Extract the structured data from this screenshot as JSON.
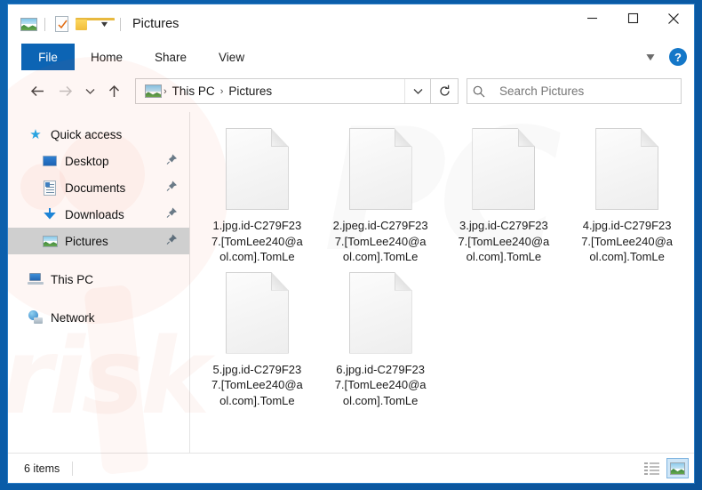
{
  "window": {
    "title": "Pictures",
    "quick_access_toolbar": [
      {
        "name": "pictures-icon",
        "label": "Pictures"
      },
      {
        "name": "properties-icon",
        "label": "Properties"
      },
      {
        "name": "new-folder-icon",
        "label": "New folder"
      },
      {
        "name": "customize-qat-chevron-icon",
        "label": "Customize Quick Access Toolbar"
      }
    ],
    "controls": {
      "minimize": "Minimize",
      "maximize": "Maximize",
      "close": "Close"
    }
  },
  "ribbon": {
    "tabs": [
      {
        "label": "File",
        "active": true
      },
      {
        "label": "Home",
        "active": false
      },
      {
        "label": "Share",
        "active": false
      },
      {
        "label": "View",
        "active": false
      }
    ],
    "collapse_label": "Minimize the Ribbon",
    "help_label": "?"
  },
  "address_bar": {
    "back_label": "Back",
    "forward_label": "Forward",
    "recent_label": "Recent locations",
    "up_label": "Up",
    "breadcrumbs": [
      "This PC",
      "Pictures"
    ],
    "separator": "›",
    "dropdown_label": "Previous locations",
    "refresh_label": "Refresh"
  },
  "search": {
    "placeholder": "Search Pictures",
    "icon": "search-icon"
  },
  "sidebar": {
    "items": [
      {
        "label": "Quick access",
        "icon": "star-icon",
        "indent": false,
        "pinned": false,
        "selected": false
      },
      {
        "label": "Desktop",
        "icon": "desktop-icon",
        "indent": true,
        "pinned": true,
        "selected": false
      },
      {
        "label": "Documents",
        "icon": "documents-icon",
        "indent": true,
        "pinned": true,
        "selected": false
      },
      {
        "label": "Downloads",
        "icon": "downloads-icon",
        "indent": true,
        "pinned": true,
        "selected": false
      },
      {
        "label": "Pictures",
        "icon": "pictures-icon",
        "indent": true,
        "pinned": true,
        "selected": true
      },
      {
        "label": "This PC",
        "icon": "this-pc-icon",
        "indent": false,
        "pinned": false,
        "selected": false
      },
      {
        "label": "Network",
        "icon": "network-icon",
        "indent": false,
        "pinned": false,
        "selected": false
      }
    ]
  },
  "files": [
    {
      "name": "1.jpg.id-C279F237.[TomLee240@aol.com].TomLe",
      "icon": "blank-file-icon"
    },
    {
      "name": "2.jpeg.id-C279F237.[TomLee240@aol.com].TomLe",
      "icon": "blank-file-icon"
    },
    {
      "name": "3.jpg.id-C279F237.[TomLee240@aol.com].TomLe",
      "icon": "blank-file-icon"
    },
    {
      "name": "4.jpg.id-C279F237.[TomLee240@aol.com].TomLe",
      "icon": "blank-file-icon"
    },
    {
      "name": "5.jpg.id-C279F237.[TomLee240@aol.com].TomLe",
      "icon": "blank-file-icon"
    },
    {
      "name": "6.jpg.id-C279F237.[TomLee240@aol.com].TomLe",
      "icon": "blank-file-icon"
    }
  ],
  "status_bar": {
    "item_count": "6 items",
    "views": [
      {
        "name": "details-view-button",
        "label": "Details view",
        "active": false
      },
      {
        "name": "large-icons-view-button",
        "label": "Large icons view",
        "active": true
      }
    ]
  },
  "watermark": {
    "text": "risk",
    "text2": "PC"
  },
  "colors": {
    "accent": "#0c64b4",
    "desktop": "#0a5ca8",
    "selection": "#cfcfcf",
    "help": "#1477c8"
  }
}
